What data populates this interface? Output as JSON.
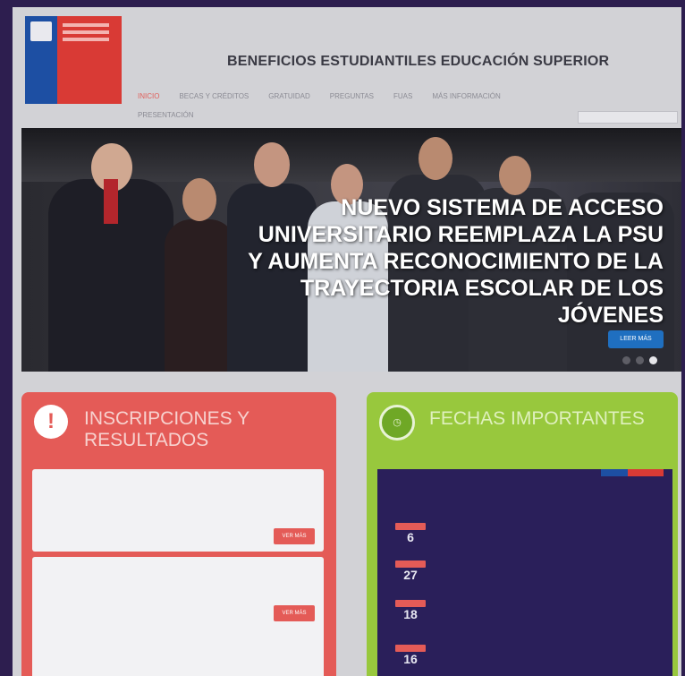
{
  "header": {
    "site_title": "BENEFICIOS ESTUDIANTILES EDUCACIÓN SUPERIOR"
  },
  "nav": {
    "items": [
      {
        "label": "INICIO",
        "active": true
      },
      {
        "label": "BECAS Y CRÉDITOS",
        "active": false
      },
      {
        "label": "GRATUIDAD",
        "active": false
      },
      {
        "label": "PREGUNTAS",
        "active": false
      },
      {
        "label": "FUAS",
        "active": false
      },
      {
        "label": "MÁS INFORMACIÓN",
        "active": false
      }
    ],
    "subnav_label": "PRESENTACIÓN"
  },
  "hero": {
    "headline": "NUEVO SISTEMA DE ACCESO UNIVERSITARIO REEMPLAZA LA PSU Y AUMENTA RECONOCIMIENTO DE LA TRAYECTORIA ESCOLAR DE LOS JÓVENES",
    "button_label": "LEER MÁS"
  },
  "inscripciones": {
    "title": "INSCRIPCIONES Y RESULTADOS",
    "icon": "exclamation-icon",
    "cards": [
      {
        "title": "",
        "lines": [
          "",
          ""
        ],
        "button": "VER MÁS"
      },
      {
        "title": "",
        "lines": [
          ""
        ],
        "button": "VER MÁS"
      }
    ]
  },
  "fechas": {
    "title": "FECHAS IMPORTANTES",
    "icon": "calendar-icon",
    "dates": [
      {
        "month": "",
        "day": "6",
        "text": ""
      },
      {
        "month": "",
        "day": "27",
        "text": ""
      },
      {
        "month": "",
        "day": "18",
        "text": ""
      },
      {
        "month": "",
        "day": "16",
        "text": ""
      }
    ]
  },
  "colors": {
    "red_panel": "#e45b57",
    "green_panel": "#98c83d",
    "gov_blue": "#1d4fa3",
    "gov_red": "#d93a35"
  }
}
